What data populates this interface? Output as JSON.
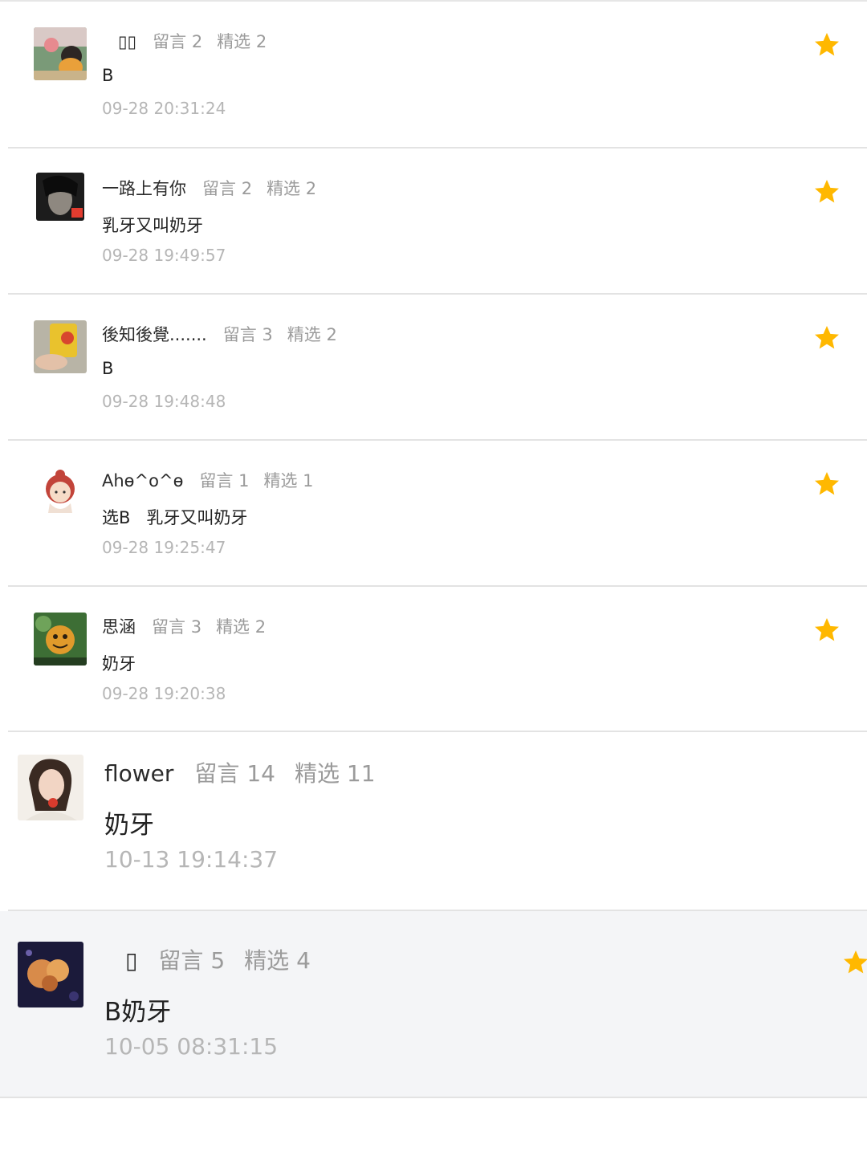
{
  "labels": {
    "comments_label": "留言",
    "featured_label": "精选"
  },
  "colors": {
    "star": "#ffb800",
    "divider": "#e3e3e3",
    "highlight_bg": "#f4f5f7",
    "time": "#b6b6b6"
  },
  "comments": [
    {
      "name": "",
      "comments": "2",
      "featured": "2",
      "body": "B",
      "time": "09-28 20:31:24",
      "starred": true,
      "icon": "star-icon"
    },
    {
      "name": "一路上有你",
      "comments": "2",
      "featured": "2",
      "body": "乳牙又叫奶牙",
      "time": "09-28 19:49:57",
      "starred": true,
      "icon": "star-icon"
    },
    {
      "name": "後知後覺.......",
      "comments": "3",
      "featured": "2",
      "body": "B",
      "time": "09-28 19:48:48",
      "starred": true,
      "icon": "star-icon"
    },
    {
      "name": "Ahɵ^o^ɵ",
      "comments": "1",
      "featured": "1",
      "body": "选B   乳牙又叫奶牙",
      "time": "09-28 19:25:47",
      "starred": true,
      "icon": "star-icon"
    },
    {
      "name": "思涵",
      "comments": "3",
      "featured": "2",
      "body": "奶牙",
      "time": "09-28 19:20:38",
      "starred": true,
      "icon": "star-icon"
    },
    {
      "name": "flower",
      "comments": "14",
      "featured": "11",
      "body": "奶牙",
      "time": "10-13 19:14:37",
      "starred": false
    },
    {
      "name": "",
      "comments": "5",
      "featured": "4",
      "body": "B奶牙",
      "time": "10-05 08:31:15",
      "starred": true,
      "icon": "star-icon"
    }
  ]
}
